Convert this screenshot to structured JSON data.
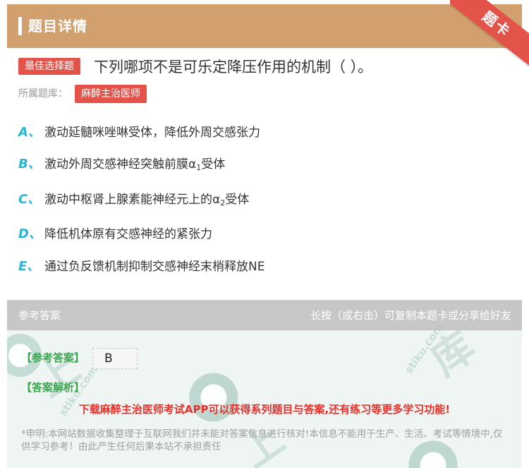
{
  "header": {
    "title": "题目详情",
    "ribbon": "题卡",
    "bg_color": "#d2a06e"
  },
  "question": {
    "type_badge": "最佳选择题",
    "text": "下列哪项不是可乐定降压作用的机制（ ）。",
    "bank_label": "所属题库：",
    "bank_name": "麻醉主治医师"
  },
  "options": [
    {
      "letter": "A、",
      "text": "激动延髓咪唑啉受体，降低外周交感张力"
    },
    {
      "letter": "B、",
      "text_pre": "激动外周交感神经突触前膜α",
      "sub": "1",
      "text_post": "受体"
    },
    {
      "letter": "C、",
      "text_pre": "激动中枢肾上腺素能神经元上的α",
      "sub": "2",
      "text_post": "受体"
    },
    {
      "letter": "D、",
      "text": "降低机体原有交感神经的紧张力"
    },
    {
      "letter": "E、",
      "text": "通过负反馈机制抑制交感神经末梢释放NE"
    }
  ],
  "answer": {
    "header_left": "参考答案",
    "header_right": "长按（或右击）可复制本题卡或分享给好友",
    "ref_label": "【参考答案】",
    "ref_value": "B",
    "analysis_label": "【答案解析】",
    "promo": "下载麻醉主治医师考试APP可以获得系列题目与答案,还有练习等更多学习功能!",
    "disclaimer": "*申明:本网站数据收集整理于互联网我们并未能对答案信息进行核对!本信息不能用于生产、生活、考试等情境中,仅供学习参考！由此产生任何后果本站不承担责任"
  },
  "watermark": {
    "brand": "上学吧",
    "url": "www.stiku.com"
  },
  "colors": {
    "accent_red": "#e4534a",
    "option_letter": "#29b6d6",
    "answer_green": "#3aa84d",
    "promo_red": "#e8302a"
  }
}
